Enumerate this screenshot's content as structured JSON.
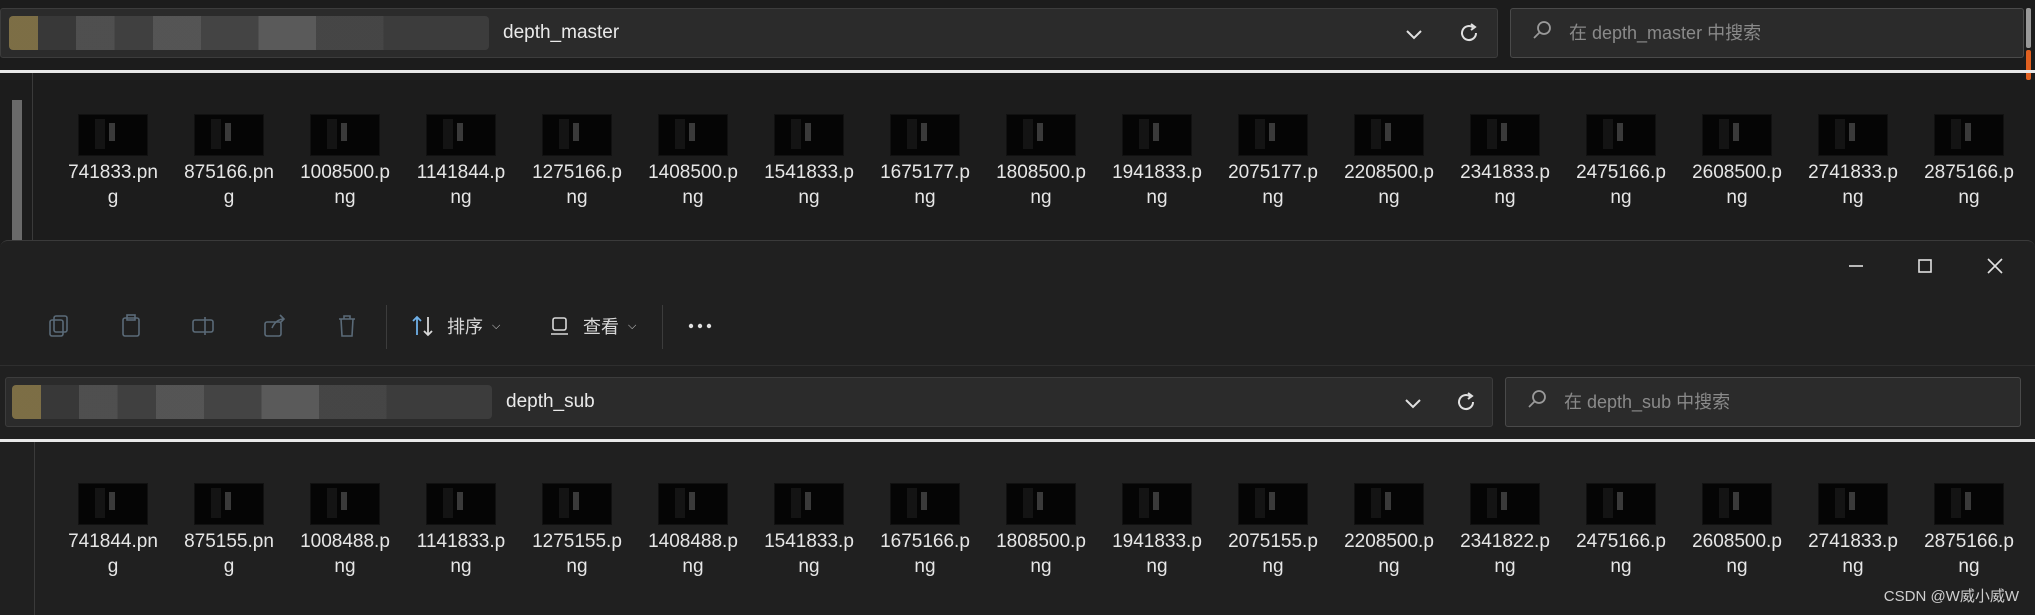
{
  "window1": {
    "path": "depth_master",
    "search_placeholder": "在 depth_master 中搜索",
    "files": [
      "741833.png",
      "875166.png",
      "1008500.png",
      "1141844.png",
      "1275166.png",
      "1408500.png",
      "1541833.png",
      "1675177.png",
      "1808500.png",
      "1941833.png",
      "2075177.png",
      "2208500.png",
      "2341833.png",
      "2475166.png",
      "2608500.png",
      "2741833.png",
      "2875166.png"
    ]
  },
  "window2": {
    "toolbar": {
      "sort_label": "排序",
      "view_label": "查看"
    },
    "path": "depth_sub",
    "search_placeholder": "在 depth_sub 中搜索",
    "files": [
      "741844.png",
      "875155.png",
      "1008488.png",
      "1141833.png",
      "1275155.png",
      "1408488.png",
      "1541833.png",
      "1675166.png",
      "1808500.png",
      "1941833.png",
      "2075155.png",
      "2208500.png",
      "2341822.png",
      "2475166.png",
      "2608500.png",
      "2741833.png",
      "2875166.png"
    ]
  },
  "watermark": "CSDN @W威小威W"
}
